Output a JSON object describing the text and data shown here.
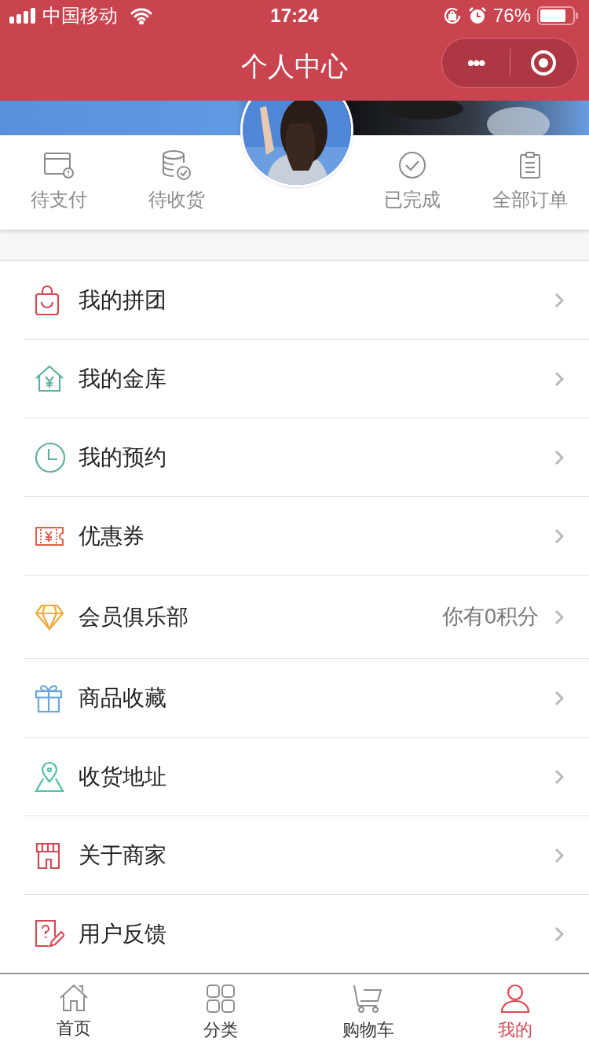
{
  "status_bar": {
    "carrier": "中国移动",
    "time": "17:24",
    "battery": "76%"
  },
  "nav": {
    "title": "个人中心",
    "more": "•••"
  },
  "orders": [
    {
      "kind": "wallet",
      "label": "待支付"
    },
    {
      "kind": "coins",
      "label": "待收货"
    },
    {
      "kind": "check",
      "label": "已完成"
    },
    {
      "kind": "clipboard",
      "label": "全部订单"
    }
  ],
  "menu": [
    {
      "kind": "bag",
      "color": "#d14b57",
      "label": "我的拼团"
    },
    {
      "kind": "house",
      "color": "#5fb0a0",
      "label": "我的金库"
    },
    {
      "kind": "clock",
      "color": "#5fb0a0",
      "label": "我的预约"
    },
    {
      "kind": "ticket",
      "color": "#e0604a",
      "label": "优惠券"
    },
    {
      "kind": "diamond",
      "color": "#f0a93a",
      "label": "会员俱乐部",
      "value": "你有0积分"
    },
    {
      "kind": "gift",
      "color": "#6aa6e0",
      "label": "商品收藏"
    },
    {
      "kind": "pin",
      "color": "#4fc0a8",
      "label": "收货地址"
    },
    {
      "kind": "shop",
      "color": "#d14b57",
      "label": "关于商家"
    },
    {
      "kind": "feedback",
      "color": "#d14b57",
      "label": "用户反馈"
    }
  ],
  "tabs": [
    {
      "kind": "home",
      "label": "首页",
      "selected": false
    },
    {
      "kind": "grid",
      "label": "分类",
      "selected": false
    },
    {
      "kind": "cart",
      "label": "购物车",
      "selected": false
    },
    {
      "kind": "user",
      "label": "我的",
      "selected": true
    }
  ]
}
